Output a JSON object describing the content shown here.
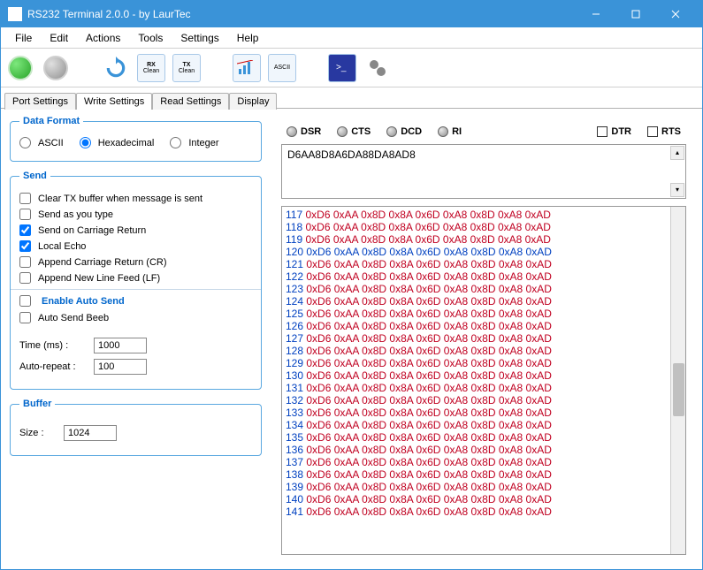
{
  "window": {
    "title": "RS232 Terminal 2.0.0  -  by  LaurTec"
  },
  "menu": [
    "File",
    "Edit",
    "Actions",
    "Tools",
    "Settings",
    "Help"
  ],
  "toolbar": {
    "rx_top": "RX",
    "rx_bot": "Clean",
    "tx_top": "TX",
    "tx_bot": "Clean",
    "ascii": "ASCII"
  },
  "tabs": [
    "Port Settings",
    "Write Settings",
    "Read Settings",
    "Display"
  ],
  "active_tab": 1,
  "left": {
    "data_format_legend": "Data Format",
    "fmt_ascii": "ASCII",
    "fmt_hex": "Hexadecimal",
    "fmt_int": "Integer",
    "send_legend": "Send",
    "chk_clear": "Clear TX buffer when message is sent",
    "chk_asyoutype": "Send as you type",
    "chk_cr": "Send on Carriage Return",
    "chk_echo": "Local Echo",
    "chk_appcr": "Append Carriage Return (CR)",
    "chk_applf": "Append New Line Feed (LF)",
    "enable_auto": "Enable Auto Send",
    "chk_beeb": "Auto Send Beeb",
    "lbl_time": "Time (ms) :",
    "val_time": "1000",
    "lbl_repeat": "Auto-repeat :",
    "val_repeat": "100",
    "buffer_legend": "Buffer",
    "lbl_size": "Size :",
    "val_size": "1024"
  },
  "status": {
    "dsr": "DSR",
    "cts": "CTS",
    "dcd": "DCD",
    "ri": "RI",
    "dtr": "DTR",
    "rts": "RTS"
  },
  "inputhex": "D6AA8D8A6DA88DA8AD8",
  "log": {
    "first_line": 117,
    "last_line": 141,
    "bytes": [
      "0xD6",
      "0xAA",
      "0x8D",
      "0x8A",
      "0x6D",
      "0xA8",
      "0x8D",
      "0xA8",
      "0xAD"
    ],
    "rx_line": 120
  }
}
